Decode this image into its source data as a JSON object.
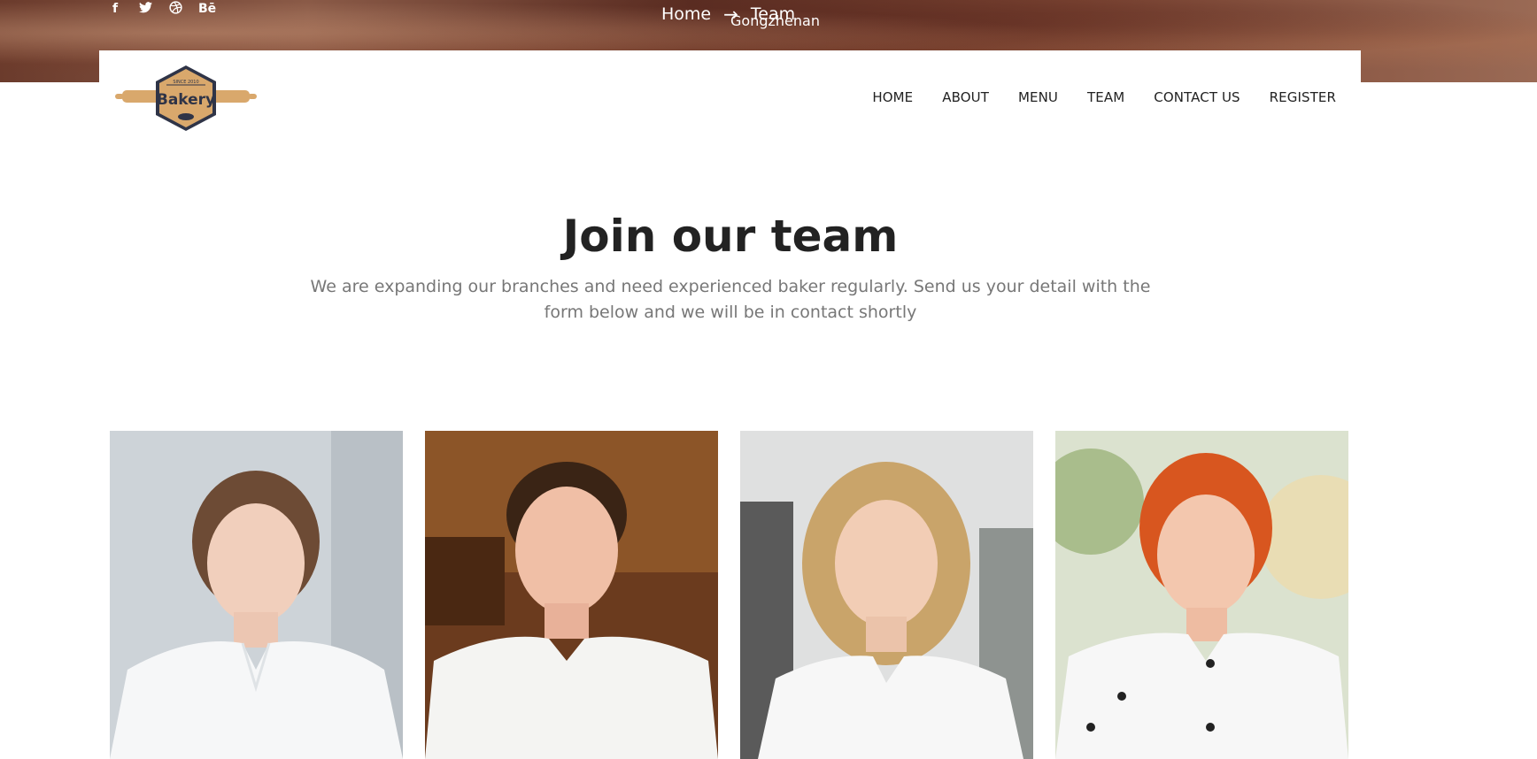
{
  "social": {
    "items": [
      {
        "icon": "facebook-icon",
        "glyph": "f"
      },
      {
        "icon": "twitter-icon",
        "glyph": "🐦"
      },
      {
        "icon": "dribbble-icon",
        "glyph": "⊛"
      },
      {
        "icon": "behance-icon",
        "glyph": "Bē"
      }
    ]
  },
  "breadcrumb": {
    "home": "Home",
    "arrow": "→",
    "current": "Team",
    "user": "Gongzhenan"
  },
  "logo": {
    "text": "Bakery",
    "since": "SINCE 2010"
  },
  "nav": {
    "items": [
      "HOME",
      "ABOUT",
      "MENU",
      "TEAM",
      "CONTACT US",
      "REGISTER"
    ]
  },
  "main": {
    "title": "Join our team",
    "subtitle": "We are expanding our branches and need experienced baker regularly. Send us your detail with the form below and we will be in contact shortly"
  },
  "colors": {
    "logo_fill": "#d9a86c",
    "logo_dark": "#2f3447",
    "text_dark": "#222222",
    "text_muted": "#777777"
  }
}
